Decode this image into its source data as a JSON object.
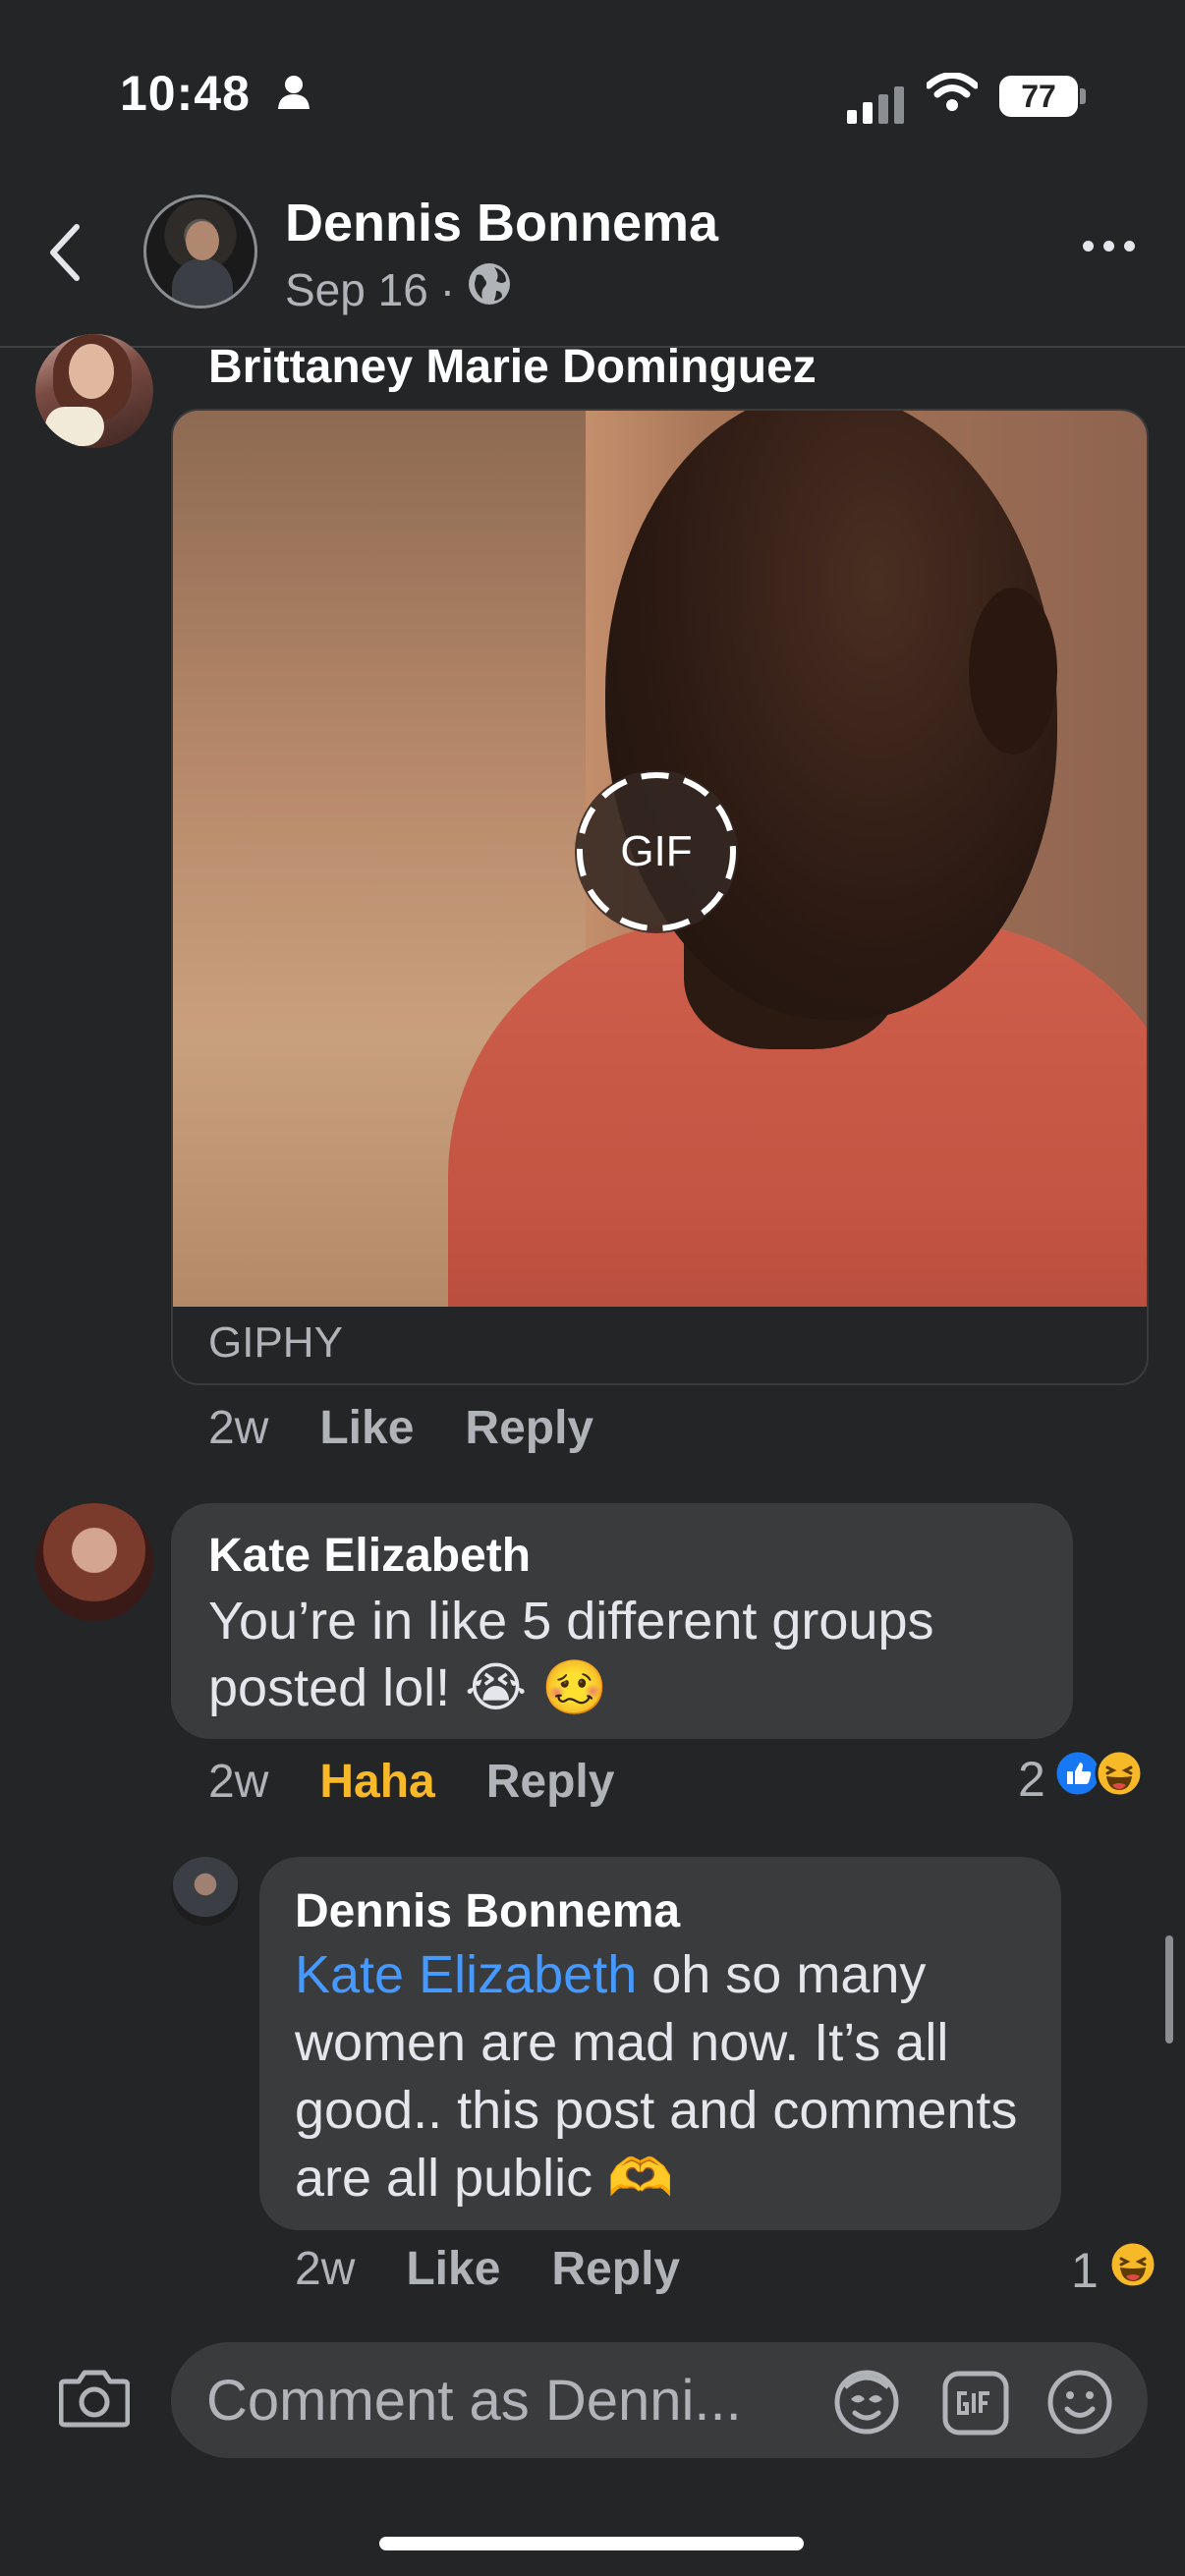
{
  "status_bar": {
    "time": "10:48",
    "battery": "77"
  },
  "header": {
    "name": "Dennis Bonnema",
    "date": "Sep 16",
    "separator": "·"
  },
  "comments": [
    {
      "author": "Brittaney Marie Dominguez",
      "attachment": {
        "badge": "GIF",
        "source": "GIPHY"
      },
      "time": "2w",
      "like_label": "Like",
      "reply_label": "Reply"
    },
    {
      "author": "Kate Elizabeth",
      "text": "You’re in like 5 different groups posted lol! 😭 🥴",
      "time": "2w",
      "like_label": "Haha",
      "reply_label": "Reply",
      "reaction_count": "2",
      "reaction_icons": [
        "like-icon",
        "haha-icon"
      ]
    },
    {
      "author": "Dennis Bonnema",
      "mention": "Kate Elizabeth",
      "text": " oh so many women are mad now. It’s all good.. this post and comments are all public 🫶",
      "time": "2w",
      "like_label": "Like",
      "reply_label": "Reply",
      "reaction_count": "1",
      "reaction_icons": [
        "haha-icon"
      ]
    }
  ],
  "composer": {
    "placeholder": "Comment as Denni..."
  },
  "colors": {
    "background": "#242526",
    "bubble": "#3a3b3c",
    "mention": "#4599ff",
    "haha": "#f7b928",
    "like_blue": "#1877f2"
  }
}
